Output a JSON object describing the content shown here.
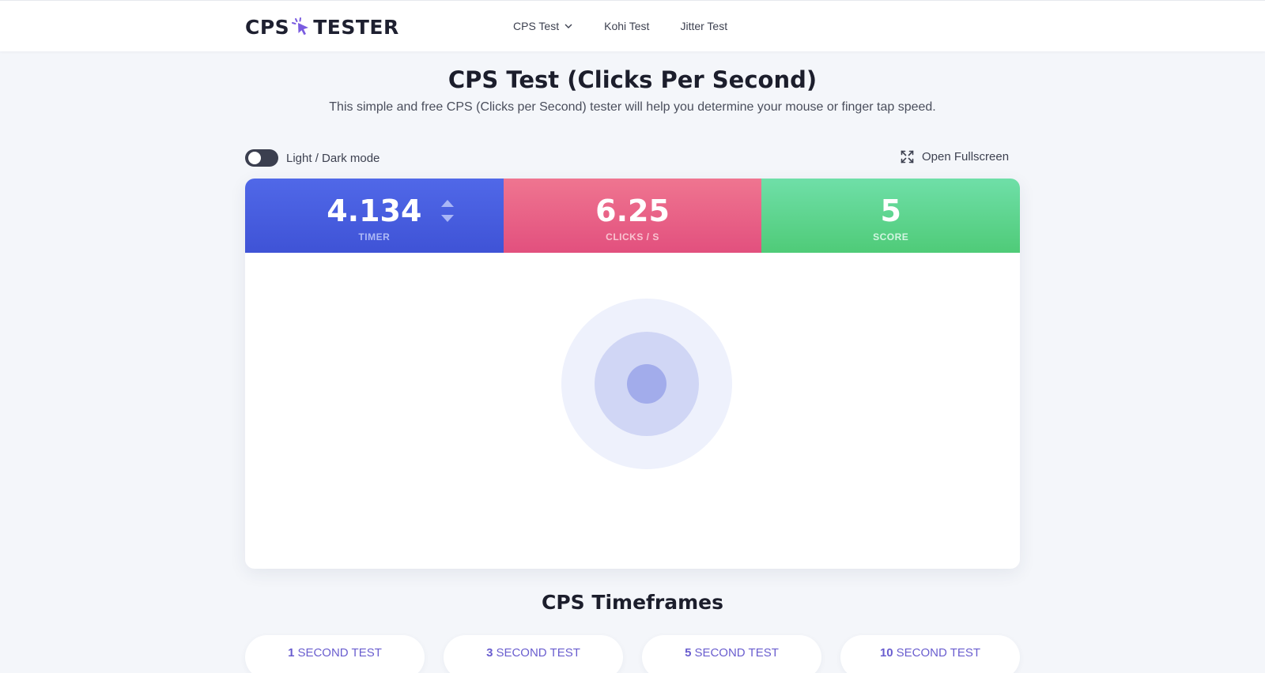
{
  "header": {
    "logo_left": "CPS",
    "logo_right": "TESTER",
    "nav": [
      {
        "label": "CPS Test",
        "has_dropdown": true
      },
      {
        "label": "Kohi Test",
        "has_dropdown": false
      },
      {
        "label": "Jitter Test",
        "has_dropdown": false
      }
    ]
  },
  "page": {
    "title": "CPS Test (Clicks Per Second)",
    "subtitle": "This simple and free CPS (Clicks per Second) tester will help you determine your mouse or finger tap speed."
  },
  "controls": {
    "toggle_label": "Light / Dark mode",
    "fullscreen_label": "Open Fullscreen"
  },
  "stats": {
    "timer": {
      "value": "4.134",
      "label": "TIMER"
    },
    "cps": {
      "value": "6.25",
      "label": "CLICKS / S"
    },
    "score": {
      "value": "5",
      "label": "SCORE"
    }
  },
  "timeframes": {
    "title": "CPS Timeframes",
    "items": [
      {
        "num": "1",
        "label": "SECOND TEST"
      },
      {
        "num": "3",
        "label": "SECOND TEST"
      },
      {
        "num": "5",
        "label": "SECOND TEST"
      },
      {
        "num": "10",
        "label": "SECOND TEST"
      }
    ]
  },
  "colors": {
    "timer": "#4a5fe2",
    "cps": "#ea6387",
    "score": "#5fd58f",
    "accent": "#6a5ecf"
  },
  "icons": {
    "logo": "cursor-click-icon",
    "fullscreen": "expand-icon",
    "nav_dropdown": "chevron-down-icon",
    "timer_adjust": "up-down-arrows-icon"
  }
}
